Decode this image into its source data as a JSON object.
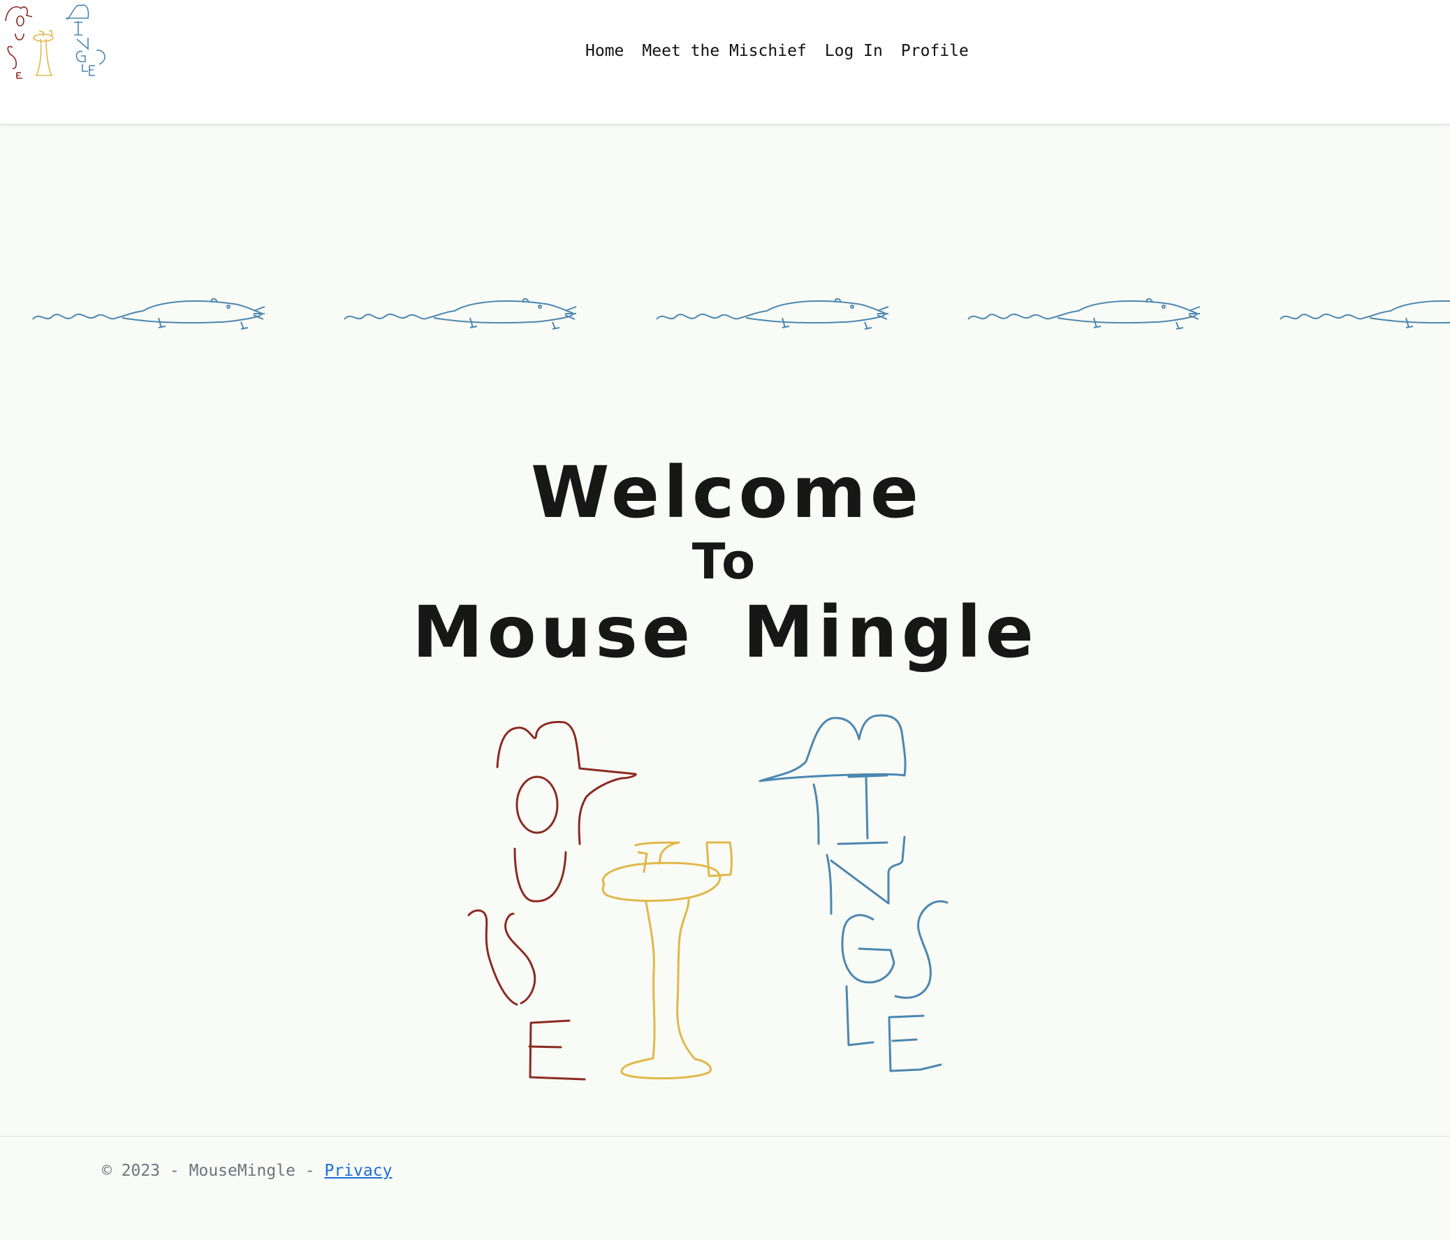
{
  "nav": {
    "items": [
      {
        "label": "Home"
      },
      {
        "label": "Meet the Mischief"
      },
      {
        "label": "Log In"
      },
      {
        "label": "Profile"
      }
    ]
  },
  "hero": {
    "line1": "Welcome",
    "line2": "To",
    "line3": "Mouse Mingle"
  },
  "logo": {
    "letters_left": "MOUSE",
    "letters_right": "MINGLE",
    "colors": {
      "left": "#8b2a22",
      "middle": "#e0b84a",
      "right": "#4b87b0"
    }
  },
  "decor": {
    "rat_color": "#4b87b0",
    "rat_count": 5
  },
  "footer": {
    "copyright": "© 2023 - MouseMingle - ",
    "privacy_label": "Privacy"
  }
}
